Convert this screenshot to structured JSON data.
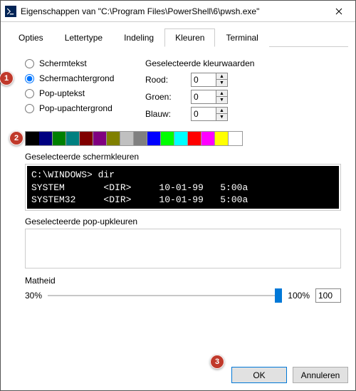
{
  "window": {
    "title": "Eigenschappen van \"C:\\Program Files\\PowerShell\\6\\pwsh.exe\""
  },
  "tabs": [
    "Opties",
    "Lettertype",
    "Indeling",
    "Kleuren",
    "Terminal"
  ],
  "active_tab": "Kleuren",
  "radios": {
    "screen_text": "Schermtekst",
    "screen_bg": "Schermachtergrond",
    "popup_text": "Pop-uptekst",
    "popup_bg": "Pop-upachtergrond",
    "selected": "screen_bg"
  },
  "color_values": {
    "title": "Geselecteerde kleurwaarden",
    "red_label": "Rood:",
    "red": 0,
    "green_label": "Groen:",
    "green": 0,
    "blue_label": "Blauw:",
    "blue": 0
  },
  "palette": [
    "#000000",
    "#000080",
    "#008000",
    "#008080",
    "#800000",
    "#800080",
    "#808000",
    "#c0c0c0",
    "#808080",
    "#0000ff",
    "#00ff00",
    "#00ffff",
    "#ff0000",
    "#ff00ff",
    "#ffff00",
    "#ffffff"
  ],
  "palette_selected_index": 0,
  "preview": {
    "screen_label": "Geselecteerde schermkleuren",
    "screen_text": "C:\\WINDOWS> dir\nSYSTEM       <DIR>     10-01-99   5:00a\nSYSTEM32     <DIR>     10-01-99   5:00a",
    "popup_label": "Geselecteerde pop-upkleuren"
  },
  "opacity": {
    "label": "Matheid",
    "min_label": "30%",
    "max_label": "100%",
    "value": 100
  },
  "buttons": {
    "ok": "OK",
    "cancel": "Annuleren"
  },
  "callouts": {
    "one": "1",
    "two": "2",
    "three": "3"
  }
}
